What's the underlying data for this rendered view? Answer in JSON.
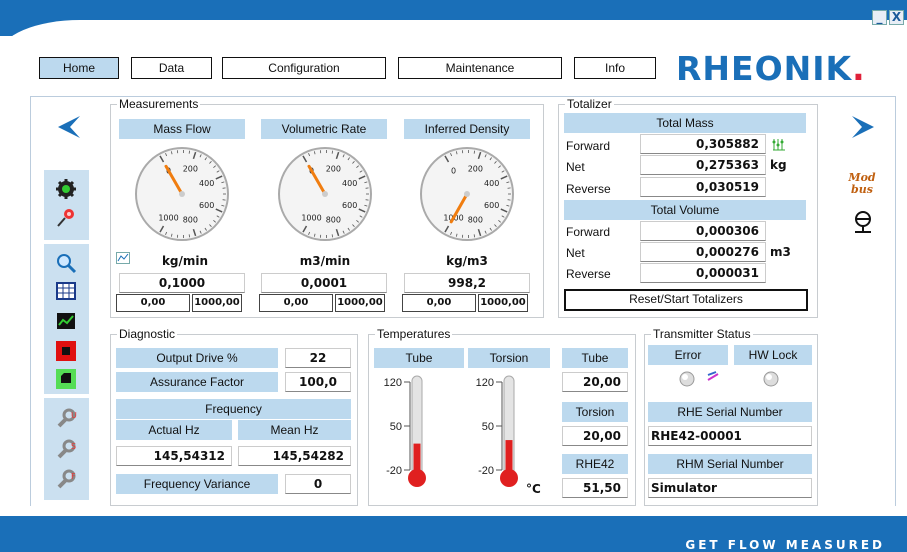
{
  "window": {
    "minimize": "_",
    "close": "X"
  },
  "nav": {
    "home": "Home",
    "data": "Data",
    "configuration": "Configuration",
    "maintenance": "Maintenance",
    "info": "Info"
  },
  "logo": {
    "text": "RHEONIK",
    "dot": "."
  },
  "slogan": "GET FLOW MEASURED",
  "modbus": "Mod bus",
  "measurements": {
    "title": "Measurements",
    "gauges": [
      {
        "title": "Mass Flow",
        "unit": "kg/min",
        "value": "0,1000",
        "min": "0,00",
        "max": "1000,00",
        "needle": 0.0001
      },
      {
        "title": "Volumetric Rate",
        "unit": "m3/min",
        "value": "0,0001",
        "min": "0,00",
        "max": "1000,00",
        "needle": 1e-07
      },
      {
        "title": "Inferred Density",
        "unit": "kg/m3",
        "value": "998,2",
        "min": "0,00",
        "max": "1000,00",
        "needle": 0.9982
      }
    ],
    "ticks": [
      "0",
      "200",
      "400",
      "600",
      "800",
      "1000"
    ]
  },
  "totalizer": {
    "title": "Totalizer",
    "mass_header": "Total Mass",
    "volume_header": "Total Volume",
    "mass": [
      {
        "label": "Forward",
        "value": "0,305882"
      },
      {
        "label": "Net",
        "value": "0,275363"
      },
      {
        "label": "Reverse",
        "value": "0,030519"
      }
    ],
    "mass_unit": "kg",
    "volume": [
      {
        "label": "Forward",
        "value": "0,000306"
      },
      {
        "label": "Net",
        "value": "0,000276"
      },
      {
        "label": "Reverse",
        "value": "0,000031"
      }
    ],
    "volume_unit": "m3",
    "reset": "Reset/Start Totalizers"
  },
  "diagnostic": {
    "title": "Diagnostic",
    "output_drive_label": "Output Drive %",
    "output_drive": "22",
    "assurance_label": "Assurance Factor",
    "assurance": "100,0",
    "frequency_header": "Frequency",
    "actual_label": "Actual Hz",
    "mean_label": "Mean Hz",
    "actual": "145,54312",
    "mean": "145,54282",
    "variance_label": "Frequency Variance",
    "variance": "0"
  },
  "temperatures": {
    "title": "Temperatures",
    "tube_header": "Tube",
    "torsion_header": "Torsion",
    "scale": [
      "120",
      "50",
      "-20"
    ],
    "unit": "°C",
    "tube_level": 0.3,
    "torsion_level": 0.34,
    "tube_label": "Tube",
    "tube": "20,00",
    "torsion_label": "Torsion",
    "torsion": "20,00",
    "rhe42_label": "RHE42",
    "rhe42": "51,50"
  },
  "transmitter": {
    "title": "Transmitter Status",
    "error": "Error",
    "hwlock": "HW Lock",
    "serial_header": "RHE Serial Number",
    "serial": "RHE42-00001",
    "rhm_header": "RHM Serial Number",
    "rhm": "Simulator"
  },
  "colors": {
    "accent": "#1a6fb8",
    "header": "#bcd9ee",
    "needle": "#f07d10",
    "thermo": "#e02020"
  }
}
